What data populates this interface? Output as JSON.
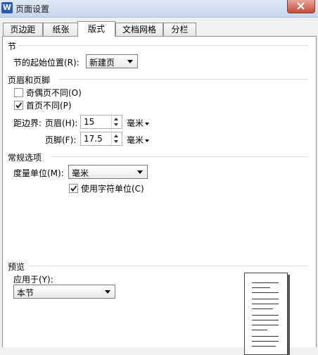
{
  "window": {
    "title": "页面设置",
    "app_icon": "W"
  },
  "tabs": [
    {
      "label": "页边距"
    },
    {
      "label": "纸张"
    },
    {
      "label": "版式"
    },
    {
      "label": "文档网格"
    },
    {
      "label": "分栏"
    }
  ],
  "section_group": {
    "heading": "节",
    "start_label": "节的起始位置(R):",
    "start_value": "新建页"
  },
  "header_footer": {
    "heading": "页眉和页脚",
    "odd_even_label": "奇偶页不同(O)",
    "odd_even_checked": false,
    "first_page_label": "首页不同(P)",
    "first_page_checked": true,
    "distance_label": "距边界:",
    "header_label": "页眉(H):",
    "header_value": "15",
    "header_unit": "毫米",
    "footer_label": "页脚(F):",
    "footer_value": "17.5",
    "footer_unit": "毫米"
  },
  "general": {
    "heading": "常规选项",
    "unit_label": "度量单位(M):",
    "unit_value": "毫米",
    "char_unit_label": "使用字符单位(C)",
    "char_unit_checked": true
  },
  "preview": {
    "heading": "预览",
    "apply_label": "应用于(Y):",
    "apply_value": "本节"
  }
}
